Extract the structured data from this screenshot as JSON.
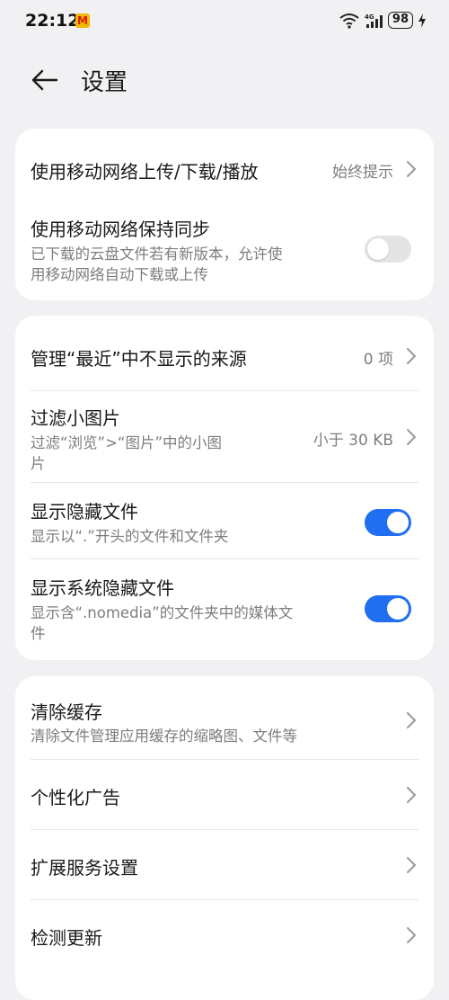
{
  "status_bar": {
    "time": "22:12",
    "battery": "98"
  },
  "header": {
    "title": "设置"
  },
  "group1": {
    "mobile_network_transfer": {
      "label": "使用移动网络上传/下载/播放",
      "value": "始终提示"
    },
    "mobile_sync": {
      "label": "使用移动网络保持同步",
      "sub_line1": "已下载的云盘文件若有新版本，允许使",
      "sub_line2": "用移动网络自动下载或上传",
      "enabled": false
    }
  },
  "group2": {
    "recent_sources": {
      "label": "管理“最近”中不显示的来源",
      "value": "0 项"
    },
    "filter_small_images": {
      "label": "过滤小图片",
      "sub_line1": "过滤“浏览”>“图片”中的小图",
      "sub_line2": "片",
      "value": "小于 30 KB"
    },
    "show_hidden": {
      "label": "显示隐藏文件",
      "sub": "显示以“.”开头的文件和文件夹",
      "enabled": true
    },
    "show_system_hidden": {
      "label": "显示系统隐藏文件",
      "sub_line1": "显示含“.nomedia”的文件夹中的媒体文",
      "sub_line2": "件",
      "enabled": true
    }
  },
  "group3": {
    "clear_cache": {
      "label": "清除缓存",
      "sub": "清除文件管理应用缓存的缩略图、文件等"
    },
    "personalized_ads": {
      "label": "个性化广告"
    },
    "extension_services": {
      "label": "扩展服务设置"
    },
    "check_update": {
      "label": "检测更新"
    }
  },
  "colors": {
    "accent": "#1f6ff0",
    "background": "#f1f1f3",
    "card": "#ffffff"
  }
}
